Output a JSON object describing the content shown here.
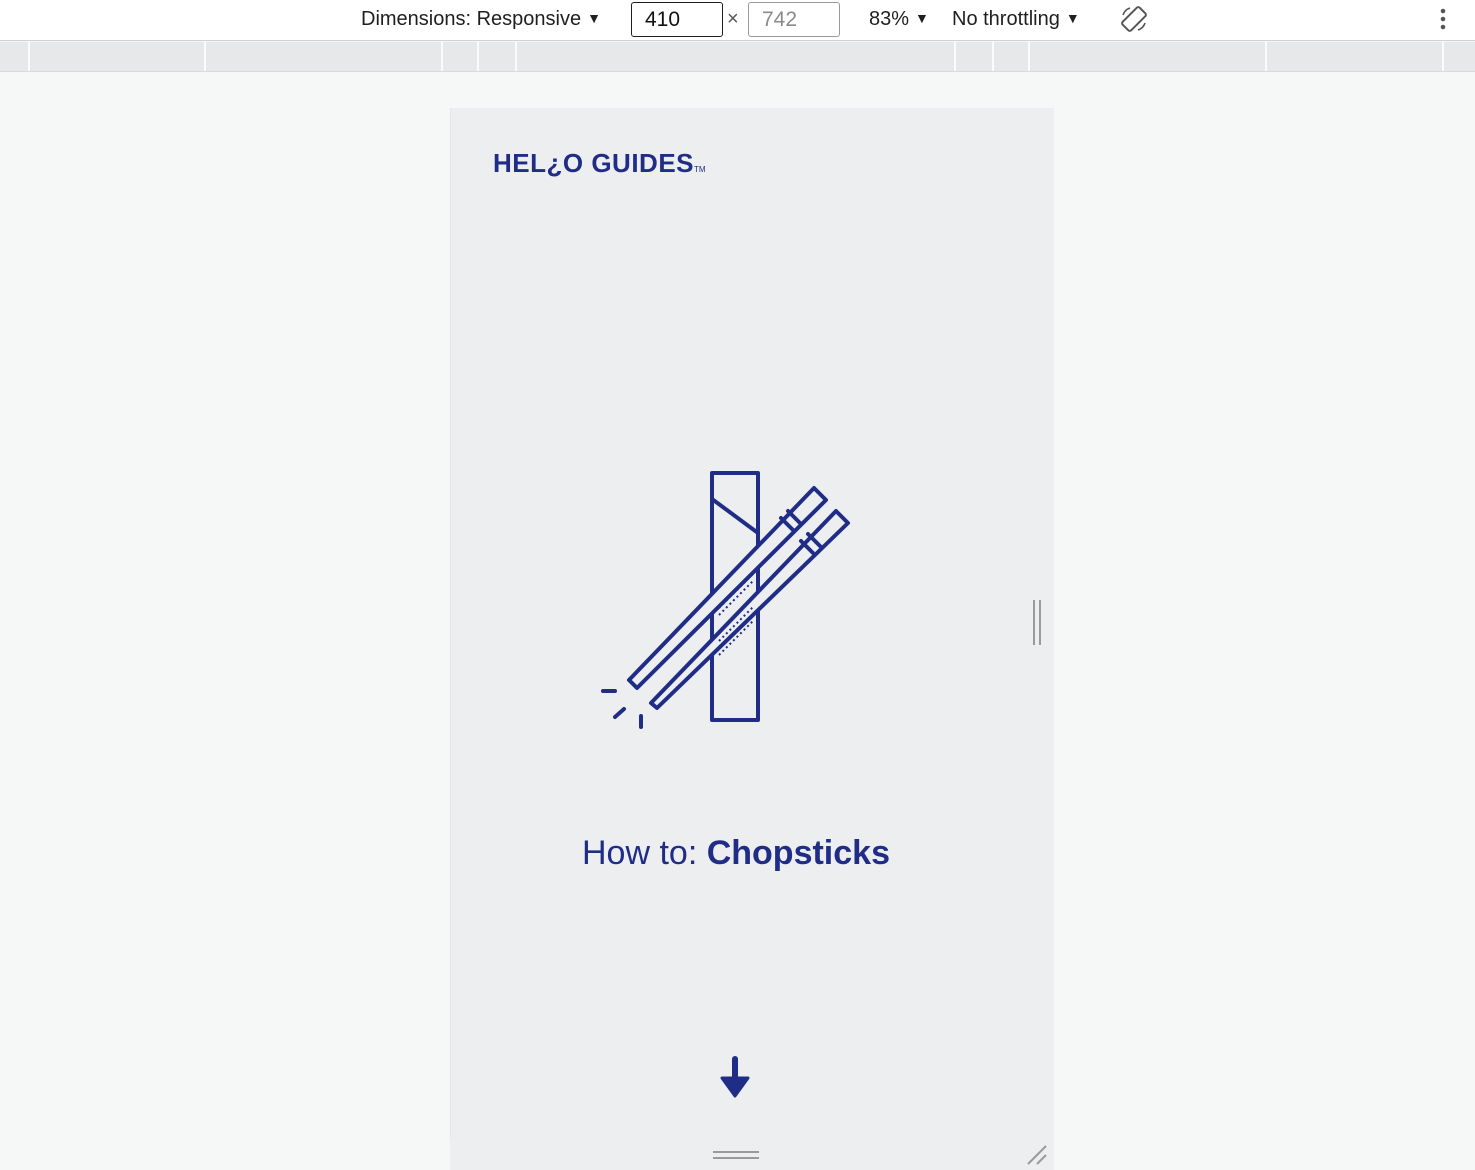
{
  "devtools": {
    "dimensions_label": "Dimensions: Responsive",
    "width_value": "410",
    "height_value": "742",
    "times_symbol": "×",
    "zoom_label": "83%",
    "throttling_label": "No throttling",
    "caret": "▼",
    "icons": {
      "rotate": "rotate-icon",
      "more": "kebab-menu-icon"
    }
  },
  "page": {
    "logo": {
      "text": "HEL¿O GUIDES",
      "tm": "TM"
    },
    "headline": {
      "prefix": "How to: ",
      "title": "Chopsticks"
    },
    "hero_icon": "chopsticks-icon",
    "scroll_icon": "arrow-down-icon"
  },
  "colors": {
    "brand": "#1f2d86",
    "viewport_bg": "#edeef0",
    "canvas_bg": "#f6f8f7"
  }
}
